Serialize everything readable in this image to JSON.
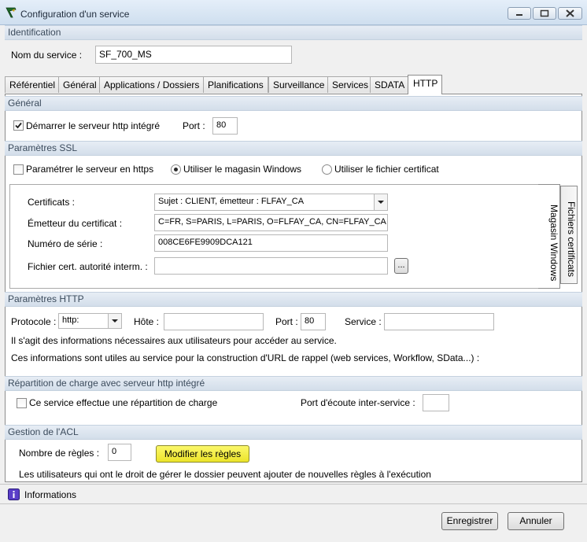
{
  "window": {
    "title": "Configuration d'un service"
  },
  "identification": {
    "header": "Identification",
    "name_label": "Nom du service :",
    "name_value": "SF_700_MS"
  },
  "tabs": [
    "Référentiel",
    "Général",
    "Applications / Dossiers",
    "Planifications",
    "Surveillance",
    "Services",
    "SDATA",
    "HTTP"
  ],
  "general": {
    "header": "Général",
    "start_label": "Démarrer le serveur http intégré",
    "port_label": "Port :",
    "port_value": "80"
  },
  "ssl": {
    "header": "Paramètres SSL",
    "https_label": "Paramétrer le serveur en https",
    "store_label": "Utiliser le magasin Windows",
    "file_label": "Utiliser le fichier certificat",
    "cert_label": "Certificats :",
    "cert_value": "Sujet : CLIENT, émetteur : FLFAY_CA",
    "issuer_label": "Émetteur du certificat :",
    "issuer_value": "C=FR, S=PARIS, L=PARIS, O=FLFAY_CA, CN=FLFAY_CA",
    "serial_label": "Numéro de série :",
    "serial_value": "008CE6FE9909DCA121",
    "interm_label": "Fichier cert. autorité interm. :",
    "interm_value": "",
    "browse_label": "...",
    "vtab_store": "Magasin Windows",
    "vtab_files": "Fichiers certificats"
  },
  "http": {
    "header": "Paramètres HTTP",
    "protocol_label": "Protocole :",
    "protocol_value": "http:",
    "host_label": "Hôte :",
    "host_value": "",
    "port_label": "Port :",
    "port_value": "80",
    "service_label": "Service :",
    "service_value": "",
    "info1": "Il s'agit des informations nécessaires aux utilisateurs pour accéder au service.",
    "info2": "Ces informations sont utiles au service pour la construction d'URL de rappel (web services, Workflow, SData...) :"
  },
  "load": {
    "header": "Répartition de charge avec serveur http intégré",
    "checkbox_label": "Ce service effectue une répartition de charge",
    "port_label": "Port d'écoute inter-service :",
    "port_value": ""
  },
  "acl": {
    "header": "Gestion de l'ACL",
    "rules_label": "Nombre de règles :",
    "rules_value": "0",
    "modify_label": "Modifier les règles",
    "note": "Les utilisateurs qui ont le droit de gérer le dossier peuvent ajouter de nouvelles règles à l'exécution"
  },
  "footer": {
    "info_label": "Informations",
    "save_label": "Enregistrer",
    "cancel_label": "Annuler"
  },
  "colors": {
    "accent_button": "#f5f03a",
    "section_bar": "#d8e2ed"
  }
}
